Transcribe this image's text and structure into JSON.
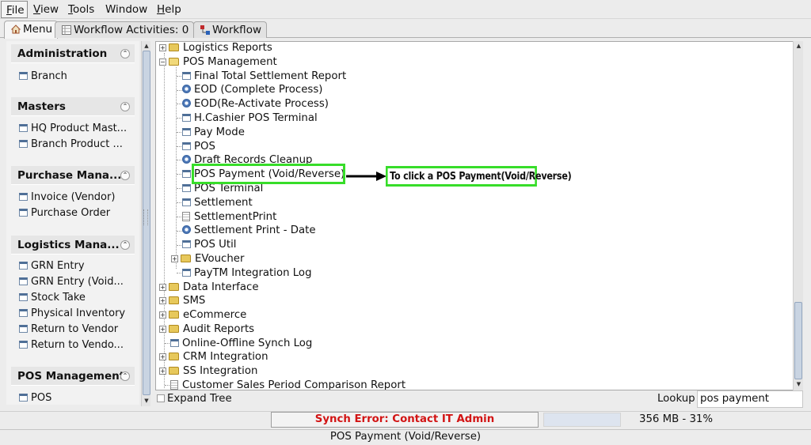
{
  "menubar": {
    "items": [
      {
        "label": "File",
        "mnemonic": "F",
        "rest": "ile"
      },
      {
        "label": "View",
        "mnemonic": "V",
        "rest": "iew"
      },
      {
        "label": "Tools",
        "mnemonic": "T",
        "rest": "ools"
      },
      {
        "label": "Window",
        "mnemonic": "",
        "rest": "Window"
      },
      {
        "label": "Help",
        "mnemonic": "H",
        "rest": "elp"
      }
    ]
  },
  "tabs": [
    {
      "label": "Menu",
      "icon": "home-icon"
    },
    {
      "label": "Workflow Activities: 0",
      "icon": "grid-icon"
    },
    {
      "label": "Workflow",
      "icon": "workflow-icon"
    }
  ],
  "sidebar": {
    "sections": [
      {
        "title": "Administration",
        "items": [
          "Branch"
        ]
      },
      {
        "title": "Masters",
        "items": [
          "HQ Product Mast...",
          "Branch Product ..."
        ]
      },
      {
        "title": "Purchase Mana...",
        "items": [
          "Invoice (Vendor)",
          "Purchase Order"
        ]
      },
      {
        "title": "Logistics Mana...",
        "items": [
          "GRN Entry",
          "GRN Entry (Void...",
          "Stock Take",
          "Physical Inventory",
          "Return to Vendor",
          "Return to Vendo..."
        ]
      },
      {
        "title": "POS Management",
        "items": [
          "POS"
        ]
      }
    ]
  },
  "tree": {
    "nodes": [
      {
        "label": "Logistics Reports",
        "type": "folder",
        "expand": "+"
      },
      {
        "label": "POS Management",
        "type": "folder-open",
        "expand": "−"
      },
      {
        "label": "Final Total Settlement Report",
        "type": "window"
      },
      {
        "label": "EOD (Complete Process)",
        "type": "process"
      },
      {
        "label": "EOD(Re-Activate Process)",
        "type": "process"
      },
      {
        "label": "H.Cashier POS Terminal",
        "type": "window"
      },
      {
        "label": "Pay Mode",
        "type": "window"
      },
      {
        "label": "POS",
        "type": "window"
      },
      {
        "label": "Draft Records Cleanup",
        "type": "process"
      },
      {
        "label": "POS Payment (Void/Reverse)",
        "type": "window"
      },
      {
        "label": "POS Terminal",
        "type": "window"
      },
      {
        "label": "Settlement",
        "type": "window"
      },
      {
        "label": "SettlementPrint",
        "type": "report"
      },
      {
        "label": "Settlement Print - Date",
        "type": "process"
      },
      {
        "label": "POS Util",
        "type": "window"
      },
      {
        "label": "EVoucher",
        "type": "folder",
        "expand": "+"
      },
      {
        "label": "PayTM Integration Log",
        "type": "window"
      },
      {
        "label": "Data Interface",
        "type": "folder",
        "expand": "+"
      },
      {
        "label": "SMS",
        "type": "folder",
        "expand": "+"
      },
      {
        "label": "eCommerce",
        "type": "folder",
        "expand": "+"
      },
      {
        "label": "Audit Reports",
        "type": "folder",
        "expand": "+"
      },
      {
        "label": "Online-Offline Synch Log",
        "type": "window"
      },
      {
        "label": "CRM Integration",
        "type": "folder",
        "expand": "+"
      },
      {
        "label": "SS Integration",
        "type": "folder",
        "expand": "+"
      },
      {
        "label": "Customer Sales Period Comparison Report",
        "type": "report"
      }
    ]
  },
  "annotation": {
    "callout": "To click a POS Payment(Void/Reverse)",
    "color": "#37dd29"
  },
  "bottom": {
    "expand_tree": "Expand Tree",
    "lookup_label": "Lookup",
    "lookup_value": "pos payment"
  },
  "status": {
    "synch_error": "Synch Error: Contact IT Admin",
    "memory": "356 MB - 31%",
    "footer": "POS Payment (Void/Reverse)"
  }
}
